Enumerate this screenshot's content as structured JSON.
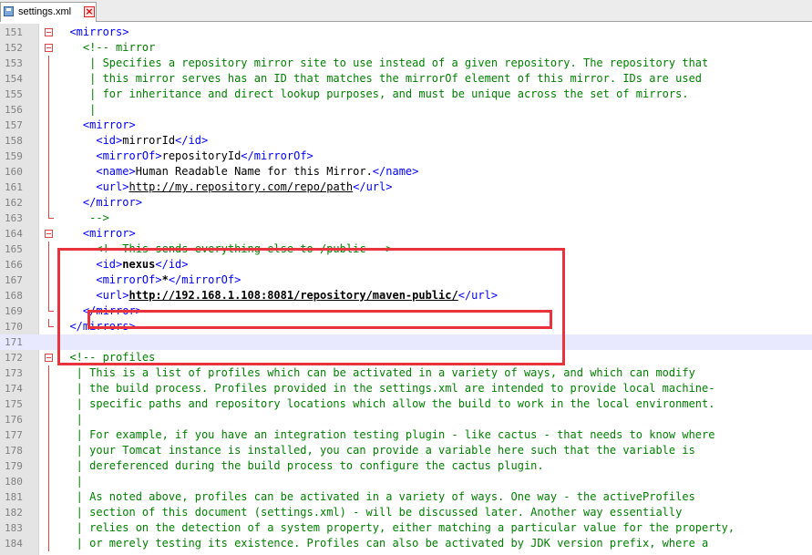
{
  "tab": {
    "label": "settings.xml",
    "save_icon": "floppy-disk-icon",
    "close_icon": "close-icon"
  },
  "colors": {
    "tag": "#0000ff",
    "comment": "#008000",
    "text": "#000000",
    "highlight_box": "#e8333c",
    "current_line": "#e8e8ff",
    "gutter": "#e4e4e4",
    "fold_marker": "#dd4444"
  },
  "editor": {
    "current_line": 171,
    "lines": [
      {
        "n": 151,
        "fold": "open",
        "segs": [
          [
            "tag",
            "  <mirrors>"
          ]
        ]
      },
      {
        "n": 152,
        "fold": "open",
        "segs": [
          [
            "cmt",
            "    <!-- mirror"
          ]
        ]
      },
      {
        "n": 153,
        "fold": "line",
        "segs": [
          [
            "cmt",
            "     | Specifies a repository mirror site to use instead of a given repository. The repository that"
          ]
        ]
      },
      {
        "n": 154,
        "fold": "line",
        "segs": [
          [
            "cmt",
            "     | this mirror serves has an ID that matches the mirrorOf element of this mirror. IDs are used"
          ]
        ]
      },
      {
        "n": 155,
        "fold": "line",
        "segs": [
          [
            "cmt",
            "     | for inheritance and direct lookup purposes, and must be unique across the set of mirrors."
          ]
        ]
      },
      {
        "n": 156,
        "fold": "line",
        "segs": [
          [
            "cmt",
            "     |"
          ]
        ]
      },
      {
        "n": 157,
        "fold": "line",
        "segs": [
          [
            "tag",
            "    <mirror>"
          ]
        ]
      },
      {
        "n": 158,
        "fold": "line",
        "segs": [
          [
            "tag",
            "      <id>"
          ],
          [
            "txt",
            "mirrorId"
          ],
          [
            "tag",
            "</id>"
          ]
        ]
      },
      {
        "n": 159,
        "fold": "line",
        "segs": [
          [
            "tag",
            "      <mirrorOf>"
          ],
          [
            "txt",
            "repositoryId"
          ],
          [
            "tag",
            "</mirrorOf>"
          ]
        ]
      },
      {
        "n": 160,
        "fold": "line",
        "segs": [
          [
            "tag",
            "      <name>"
          ],
          [
            "txt",
            "Human Readable Name for this Mirror."
          ],
          [
            "tag",
            "</name>"
          ]
        ]
      },
      {
        "n": 161,
        "fold": "line",
        "segs": [
          [
            "tag",
            "      <url>"
          ],
          [
            "url",
            "http://my.repository.com/repo/path"
          ],
          [
            "tag",
            "</url>"
          ]
        ]
      },
      {
        "n": 162,
        "fold": "line",
        "segs": [
          [
            "tag",
            "    </mirror>"
          ]
        ]
      },
      {
        "n": 163,
        "fold": "end",
        "segs": [
          [
            "cmt",
            "     -->"
          ]
        ]
      },
      {
        "n": 164,
        "fold": "open",
        "segs": [
          [
            "tag",
            "    <mirror>"
          ]
        ]
      },
      {
        "n": 165,
        "fold": "line",
        "segs": [
          [
            "cmt",
            "      <!--This sends everything else to /public -->"
          ]
        ]
      },
      {
        "n": 166,
        "fold": "line",
        "segs": [
          [
            "tag",
            "      <id>"
          ],
          [
            "txtb",
            "nexus"
          ],
          [
            "tag",
            "</id>"
          ]
        ]
      },
      {
        "n": 167,
        "fold": "line",
        "segs": [
          [
            "tag",
            "      <mirrorOf>"
          ],
          [
            "txtb",
            "*"
          ],
          [
            "tag",
            "</mirrorOf>"
          ]
        ]
      },
      {
        "n": 168,
        "fold": "line",
        "segs": [
          [
            "tag",
            "      <url>"
          ],
          [
            "urlb",
            "http://192.168.1.108:8081/repository/maven-public/"
          ],
          [
            "tag",
            "</url>"
          ]
        ]
      },
      {
        "n": 169,
        "fold": "end",
        "segs": [
          [
            "tag",
            "    </mirror>"
          ]
        ]
      },
      {
        "n": 170,
        "fold": "end",
        "segs": [
          [
            "tag",
            "  </mirrors>"
          ]
        ]
      },
      {
        "n": 171,
        "fold": "none",
        "segs": []
      },
      {
        "n": 172,
        "fold": "open",
        "segs": [
          [
            "cmt",
            "  <!-- profiles"
          ]
        ]
      },
      {
        "n": 173,
        "fold": "line",
        "segs": [
          [
            "cmt",
            "   | This is a list of profiles which can be activated in a variety of ways, and which can modify"
          ]
        ]
      },
      {
        "n": 174,
        "fold": "line",
        "segs": [
          [
            "cmt",
            "   | the build process. Profiles provided in the settings.xml are intended to provide local machine-"
          ]
        ]
      },
      {
        "n": 175,
        "fold": "line",
        "segs": [
          [
            "cmt",
            "   | specific paths and repository locations which allow the build to work in the local environment."
          ]
        ]
      },
      {
        "n": 176,
        "fold": "line",
        "segs": [
          [
            "cmt",
            "   |"
          ]
        ]
      },
      {
        "n": 177,
        "fold": "line",
        "segs": [
          [
            "cmt",
            "   | For example, if you have an integration testing plugin - like cactus - that needs to know where"
          ]
        ]
      },
      {
        "n": 178,
        "fold": "line",
        "segs": [
          [
            "cmt",
            "   | your Tomcat instance is installed, you can provide a variable here such that the variable is"
          ]
        ]
      },
      {
        "n": 179,
        "fold": "line",
        "segs": [
          [
            "cmt",
            "   | dereferenced during the build process to configure the cactus plugin."
          ]
        ]
      },
      {
        "n": 180,
        "fold": "line",
        "segs": [
          [
            "cmt",
            "   |"
          ]
        ]
      },
      {
        "n": 181,
        "fold": "line",
        "segs": [
          [
            "cmt",
            "   | As noted above, profiles can be activated in a variety of ways. One way - the activeProfiles"
          ]
        ]
      },
      {
        "n": 182,
        "fold": "line",
        "segs": [
          [
            "cmt",
            "   | section of this document (settings.xml) - will be discussed later. Another way essentially"
          ]
        ]
      },
      {
        "n": 183,
        "fold": "line",
        "segs": [
          [
            "cmt",
            "   | relies on the detection of a system property, either matching a particular value for the property,"
          ]
        ]
      },
      {
        "n": 184,
        "fold": "line",
        "segs": [
          [
            "cmt",
            "   | or merely testing its existence. Profiles can also be activated by JDK version prefix, where a"
          ]
        ]
      }
    ]
  }
}
